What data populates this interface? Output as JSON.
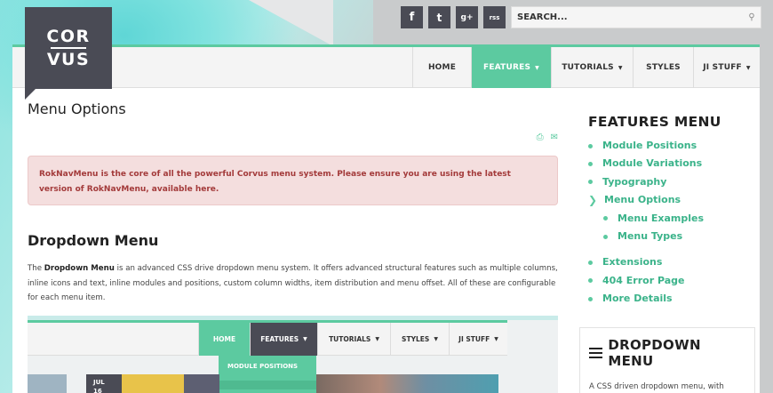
{
  "brand": {
    "logo_line1": "COR",
    "logo_line2": "VUS"
  },
  "social": [
    {
      "name": "facebook",
      "glyph": "f"
    },
    {
      "name": "twitter",
      "glyph": "t"
    },
    {
      "name": "google-plus",
      "glyph": "g+"
    },
    {
      "name": "rss",
      "glyph": "rss"
    }
  ],
  "search": {
    "placeholder": "SEARCH..."
  },
  "nav": {
    "home": "HOME",
    "features": "FEATURES",
    "tutorials": "TUTORIALS",
    "styles": "STYLES",
    "ji_stuff": "JI STUFF"
  },
  "main": {
    "title": "Menu Options",
    "alert": "RokNavMenu is the core of all the powerful Corvus menu system. Please ensure you are using the latest version of RokNavMenu, available here.",
    "section_title": "Dropdown Menu",
    "para_lead": "The ",
    "para_bold": "Dropdown Menu",
    "para_rest": " is an advanced CSS drive dropdown menu system. It offers advanced structural features such as multiple columns, inline icons and text, inline modules and positions, custom column widths, item distribution and menu offset. All of these are configurable for each menu item."
  },
  "demo": {
    "home": "HOME",
    "features": "FEATURES",
    "tutorials": "TUTORIALS",
    "styles": "STYLES",
    "ji_stuff": "JI STUFF",
    "dropdown_item": "MODULE POSITIONS",
    "date_month": "JUL",
    "date_day": "16"
  },
  "sidebar": {
    "title": "FEATURES MENU",
    "items": [
      {
        "label": "Module Positions"
      },
      {
        "label": "Module Variations"
      },
      {
        "label": "Typography"
      },
      {
        "label": "Menu Options"
      },
      {
        "label": "Menu Examples"
      },
      {
        "label": "Menu Types"
      },
      {
        "label": "Extensions"
      },
      {
        "label": "404 Error Page"
      },
      {
        "label": "More Details"
      }
    ]
  },
  "widget": {
    "title": "DROPDOWN MENU",
    "text": "A CSS driven dropdown menu, with subtext line, multi-columns, icons and"
  },
  "colors": {
    "accent": "#5ccaa0",
    "dark": "#4a4b55",
    "alert_bg": "#f4dede",
    "alert_text": "#a33a3a"
  }
}
